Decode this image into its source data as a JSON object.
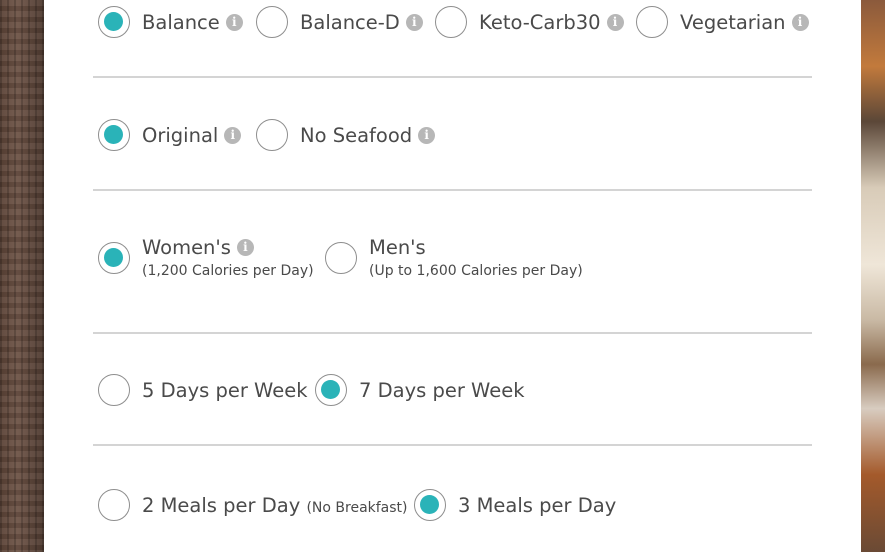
{
  "program_types": [
    {
      "label": "Balance",
      "selected": true,
      "info": "i"
    },
    {
      "label": "Balance-D",
      "selected": false,
      "info": "i"
    },
    {
      "label": "Keto-Carb30",
      "selected": false,
      "info": "i"
    },
    {
      "label": "Vegetarian",
      "selected": false,
      "info": "i"
    }
  ],
  "menu_types": [
    {
      "label": "Original",
      "selected": true,
      "info": "i"
    },
    {
      "label": "No Seafood",
      "selected": false,
      "info": "i"
    }
  ],
  "plans": [
    {
      "label": "Women's",
      "sub": "(1,200 Calories per Day)",
      "selected": true,
      "info": "i"
    },
    {
      "label": "Men's",
      "sub": "(Up to 1,600 Calories per Day)",
      "selected": false
    }
  ],
  "days": [
    {
      "label": "5 Days per Week",
      "selected": false
    },
    {
      "label": "7 Days per Week",
      "selected": true
    }
  ],
  "meals": [
    {
      "label": "2 Meals per Day",
      "note": "(No Breakfast)",
      "selected": false
    },
    {
      "label": "3 Meals per Day",
      "selected": true
    }
  ],
  "colors": {
    "accent": "#2ab3b8",
    "divider": "#d4d4d4",
    "info_icon": "#b7b7b7"
  }
}
